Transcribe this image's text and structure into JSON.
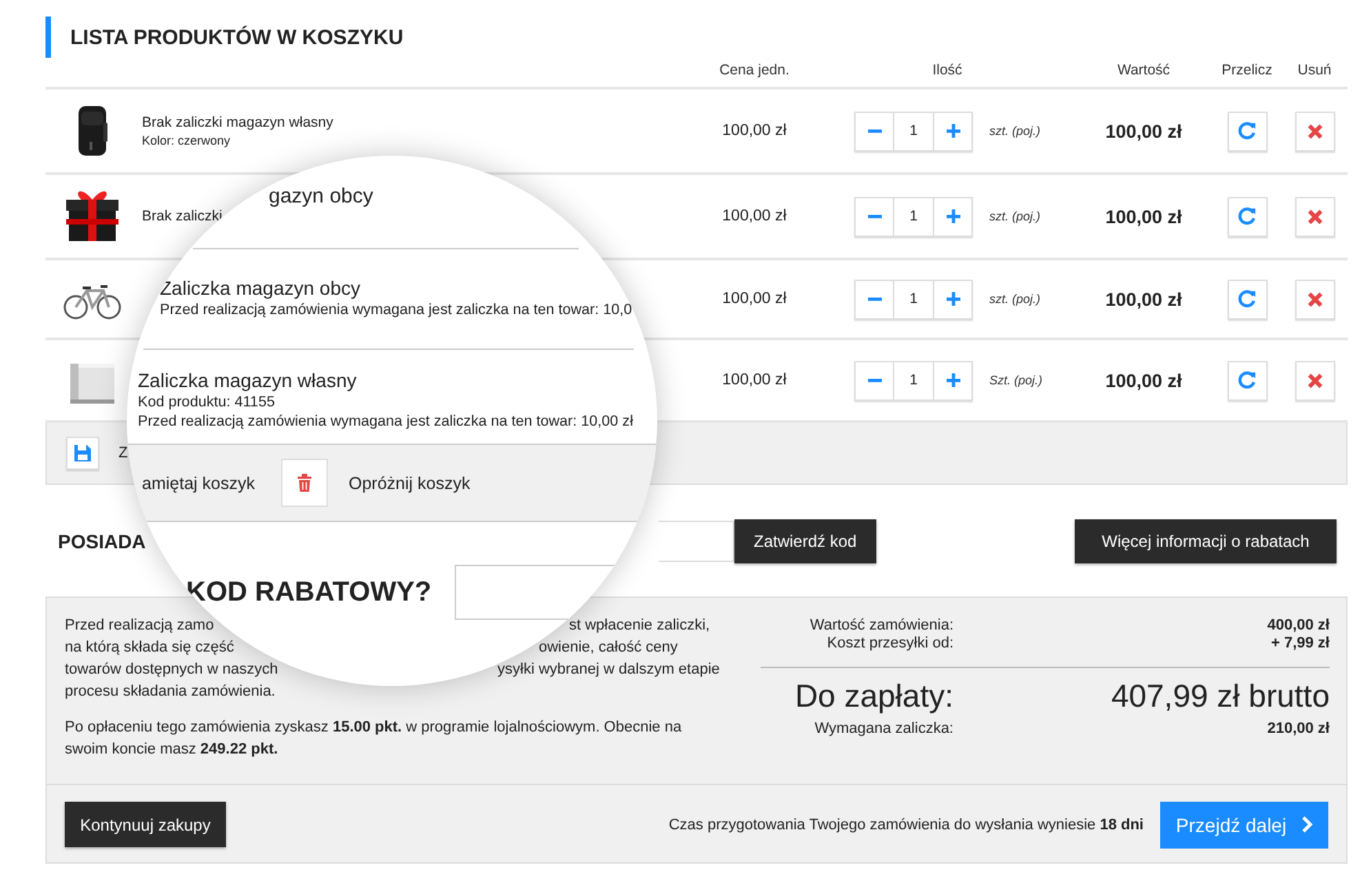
{
  "header": {
    "title": "LISTA PRODUKTÓW W KOSZYKU"
  },
  "columns": [
    "Cena jedn.",
    "Ilość",
    "Wartość",
    "Przelicz",
    "Usuń"
  ],
  "items": [
    {
      "name": "Brak zaliczki magazyn własny",
      "detail": "Kolor: czerwony",
      "price": "100,00 zł",
      "quantity": "1",
      "unit": "szt. (poj.)",
      "total": "100,00 zł"
    },
    {
      "name": "Brak zaliczki",
      "price": "100,00 zł",
      "quantity": "1",
      "unit": "szt. (poj.)",
      "total": "100,00 zł"
    },
    {
      "price": "100,00 zł",
      "quantity": "1",
      "unit": "szt. (poj.)",
      "total": "100,00 zł"
    },
    {
      "price": "100,00 zł",
      "quantity": "1",
      "unit": "Szt. (poj.)",
      "total": "100,00 zł"
    }
  ],
  "cart_bar": {
    "save_label": "Z"
  },
  "discount": {
    "label": "POSIADA",
    "submit": "Zatwierdź kod",
    "more": "Więcej informacji o rabatach"
  },
  "summary": {
    "lines": [
      {
        "left": "Przed realizacją zamo",
        "right": "st wpłacenie zaliczki,"
      },
      {
        "left": "na którą składa się część",
        "right": "owienie, całość ceny"
      },
      {
        "left": "towarów dostępnych w naszych",
        "right": "ysyłki wybranej w dalszym etapie"
      },
      {
        "left": "procesu składania zamówienia."
      }
    ],
    "loyalty": "Po opłaceniu tego zamówienia zyskasz **15.00 pkt.** w programie lojalnościowym. Obecnie na swoim koncie masz **249.22 pkt.**",
    "totals": [
      {
        "kind": "line",
        "label": "Wartość zamówienia:",
        "value": "400,00 zł"
      },
      {
        "kind": "line",
        "label": "Koszt przesyłki od:",
        "value": "+ 7,99 zł"
      },
      {
        "kind": "grand",
        "label": "Do zapłaty:",
        "value": "407,99 zł brutto"
      },
      {
        "kind": "line",
        "label": "Wymagana zaliczka:",
        "value": "210,00 zł"
      }
    ]
  },
  "footer": {
    "continue": "Kontynuuj zakupy",
    "note": "Czas przygotowania Twojego zamówienia do wysłania wyniesie **18 dni**",
    "next": "Przejdź dalej"
  },
  "magnifier": {
    "partial_title": "gazyn obcy",
    "items": [
      {
        "name": "Zaliczka magazyn obcy",
        "details": [
          "Przed realizacją zamówienia wymagana jest zaliczka na ten towar: 10,0"
        ]
      },
      {
        "name": "Zaliczka magazyn własny",
        "details": [
          "Kod produktu: 41155",
          "Przed realizacją zamówienia wymagana jest zaliczka na ten towar: 10,00 zł"
        ]
      }
    ],
    "save_label": "amiętaj koszyk",
    "clear_label": "Opróżnij koszyk",
    "discount_title": "KOD RABATOWY?"
  }
}
